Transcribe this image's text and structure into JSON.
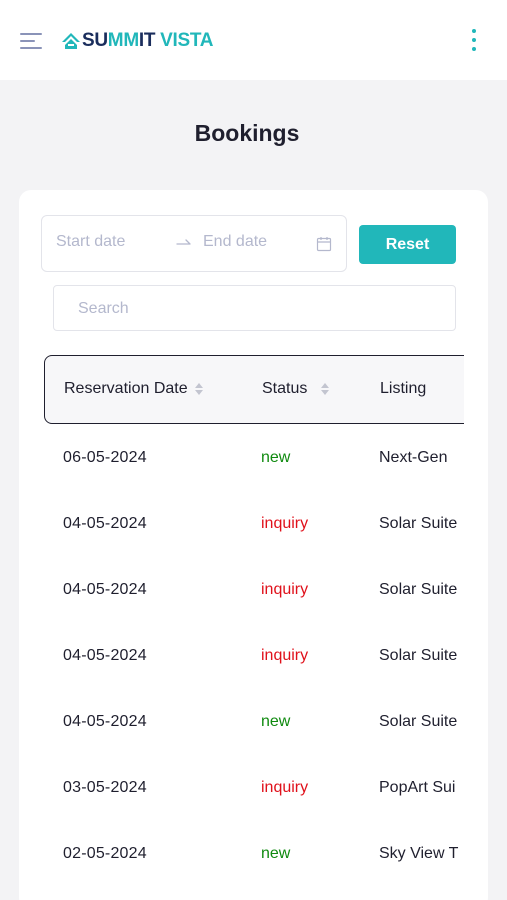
{
  "header": {
    "logo_part1": "SU",
    "logo_part1b": "MM",
    "logo_part1c": "IT",
    "logo_part2": "VISTA"
  },
  "page": {
    "title": "Bookings"
  },
  "filters": {
    "start_placeholder": "Start date",
    "end_placeholder": "End date",
    "reset_label": "Reset",
    "search_placeholder": "Search"
  },
  "table": {
    "columns": [
      "Reservation Date",
      "Status",
      "Listing"
    ],
    "rows": [
      {
        "date": "06-05-2024",
        "status": "new",
        "listing": "Next-Gen"
      },
      {
        "date": "04-05-2024",
        "status": "inquiry",
        "listing": "Solar Suite"
      },
      {
        "date": "04-05-2024",
        "status": "inquiry",
        "listing": "Solar Suite"
      },
      {
        "date": "04-05-2024",
        "status": "inquiry",
        "listing": "Solar Suite"
      },
      {
        "date": "04-05-2024",
        "status": "new",
        "listing": "Solar Suite"
      },
      {
        "date": "03-05-2024",
        "status": "inquiry",
        "listing": "PopArt Sui"
      },
      {
        "date": "02-05-2024",
        "status": "new",
        "listing": "Sky View T"
      }
    ]
  },
  "colors": {
    "accent": "#21b7ba",
    "brand_dark": "#1a2d5c",
    "status_new": "#0f8a0f",
    "status_inquiry": "#e0111b"
  },
  "icons": {
    "menu": "hamburger-menu-icon",
    "logo": "mountain-logo-icon",
    "more": "kebab-menu-icon",
    "range_arrow": "arrow-right-icon",
    "calendar": "calendar-icon",
    "sort": "sort-icon"
  }
}
